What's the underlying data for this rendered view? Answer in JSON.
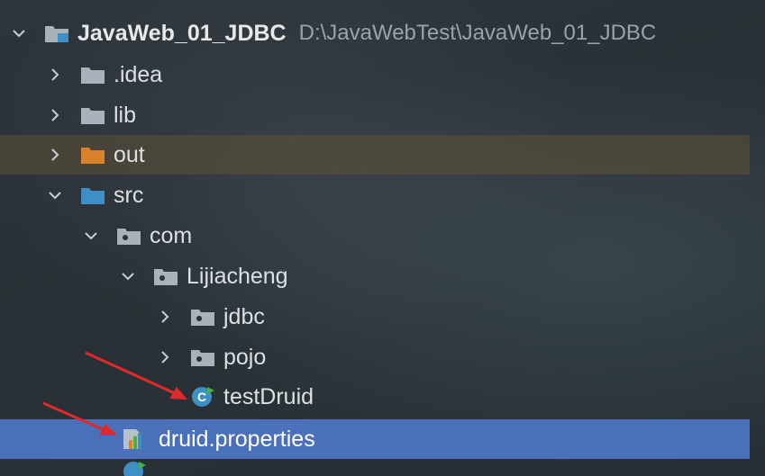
{
  "project": {
    "name": "JavaWeb_01_JDBC",
    "path": "D:\\JavaWebTest\\JavaWeb_01_JDBC"
  },
  "tree": {
    "idea": ".idea",
    "lib": "lib",
    "out": "out",
    "src": "src",
    "com": "com",
    "lijiacheng": "Lijiacheng",
    "jdbc": "jdbc",
    "pojo": "pojo",
    "testDruid": "testDruid",
    "druidProperties": "druid.properties"
  },
  "colors": {
    "selection": "#4a70b9",
    "excluded_folder": "#d9822b",
    "source_folder": "#3d8fc6",
    "annotation_arrow": "#e02a2a"
  },
  "icons": {
    "expanded": "chevron-down-icon",
    "collapsed": "chevron-right-icon",
    "folder": "folder-icon",
    "package": "package-icon",
    "java_class": "java-class-icon",
    "properties_file": "properties-file-icon"
  }
}
